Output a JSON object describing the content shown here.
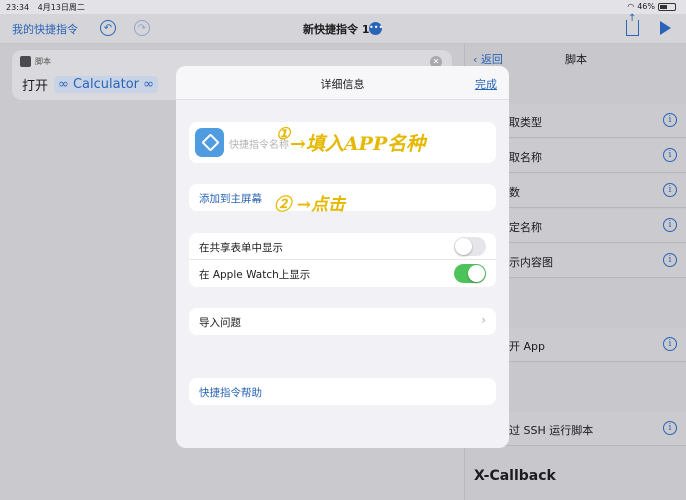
{
  "status_bar": {
    "time": "23:34",
    "date": "4月13日周二",
    "battery": "46%"
  },
  "toolbar": {
    "back_label": "我的快捷指令",
    "title": "新快捷指令 1",
    "title_badge": "•••"
  },
  "action_card": {
    "category": "脚本",
    "verb": "打开",
    "token": "∞ Calculator ∞"
  },
  "right_panel": {
    "back_label": "返回",
    "title": "脚本",
    "rows": [
      {
        "label": "取类型"
      },
      {
        "label": "取名称"
      },
      {
        "label": "数"
      },
      {
        "label": "定名称"
      },
      {
        "label": "示内容图"
      },
      {
        "label": "开 App"
      },
      {
        "label": "过 SSH 运行脚本"
      }
    ],
    "section": "X-Callback"
  },
  "modal": {
    "title": "详细信息",
    "done_label": "完成",
    "name_placeholder": "快捷指令名称",
    "add_home_label": "添加到主屏幕",
    "share_sheet_label": "在共享表单中显示",
    "share_sheet_on": false,
    "watch_label": "在 Apple Watch上显示",
    "watch_on": true,
    "import_label": "导入问题",
    "help_label": "快捷指令帮助"
  },
  "annotations": {
    "step1_mark": "①",
    "step1_text": "→填入APP名种",
    "step2_text": "② →点击"
  },
  "colors": {
    "accent": "#2a64b6",
    "toggle_on": "#4cc35b",
    "annotation": "#e6b800"
  }
}
